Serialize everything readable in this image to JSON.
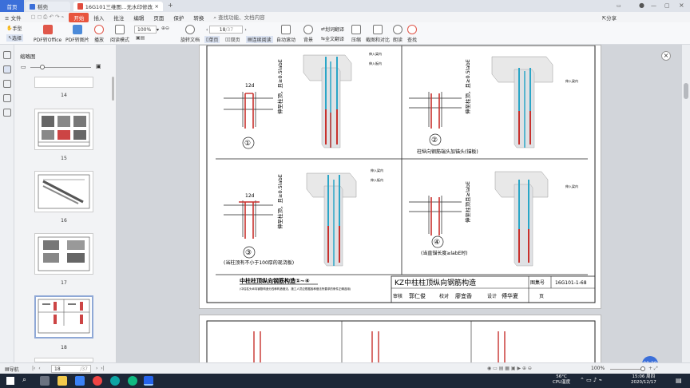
{
  "tabs": {
    "home": "首页",
    "app": "稻壳",
    "doc": "16G101三维图…无水印修改.pdf"
  },
  "menu": {
    "file": "文件",
    "start": "开始",
    "insert": "插入",
    "annotate": "批注",
    "edit": "编辑",
    "page": "页面",
    "protect": "保护",
    "convert": "转换",
    "search": "查找功能、文档内容",
    "share": "分享"
  },
  "toolbar": {
    "hand": "手型",
    "select": "选择",
    "pdf_office": "PDF转Office",
    "pdf_image": "PDF转图片",
    "play": "播放",
    "read_mode": "阅读模式",
    "zoom": "100%",
    "rotate": "旋转文档",
    "page_num": "18",
    "page_total": "/37",
    "single": "单页",
    "double": "双页",
    "continuous": "连续阅读",
    "auto_scroll": "自动滚动",
    "background": "背景",
    "translate_word": "划词翻译",
    "translate_all": "全文翻译",
    "compress": "压缩",
    "compare": "截图和对比",
    "read_aloud": "朗读",
    "find": "查找"
  },
  "sidebar": {
    "title": "缩略图",
    "pages": [
      "14",
      "15",
      "16",
      "17",
      "18"
    ]
  },
  "drawing": {
    "label_1": "①",
    "label_2": "②",
    "label_3": "③",
    "label_4": "④",
    "vert_text_1": "伸至柱顶，且≥0.5labE",
    "vert_text_2": "伸至柱顶，且≥0.5labE",
    "vert_text_3": "伸至柱顶，且≥0.5labE",
    "vert_text_4": "伸至柱顶且≥labE",
    "dim_12d": "12d",
    "note_2": "柱纵向钢筋端头加锚头(锚板)",
    "note_3": "(当柱顶有不小于100厚的现浇板)",
    "note_4": "(当直锚长度≥labE时)",
    "subtitle": "中柱柱顶纵向钢筋构造①~④",
    "subnote": "(中柱柱头纵向钢筋构造分四种构造做法，施工人员应根据各种做法所要求的条件正确选用)",
    "title_main": "KZ中柱柱顶纵向钢筋构造",
    "atlas_label": "图集号",
    "atlas_no": "16G101-1-68",
    "review_label": "审核",
    "reviewer": "郭仁俊",
    "check_label": "校对",
    "checker": "廖宜香",
    "design_label": "设计",
    "designer": "傅华夏",
    "page_label": "页",
    "tag_a": "伸入梁内",
    "tag_b": "伸入板内"
  },
  "status": {
    "nav": "导航",
    "page": "18",
    "total": "/37",
    "zoom": "100%"
  },
  "taskbar": {
    "temp": "56°C",
    "cpu": "CPU温度",
    "time": "15:06 周四",
    "date": "2020/12/17",
    "timer": "00:29"
  },
  "colors": {
    "accent": "#3b6fd9",
    "menu_active": "#e8553e",
    "rebar_red": "#c8312d",
    "rebar_cyan": "#2aa6c7"
  }
}
